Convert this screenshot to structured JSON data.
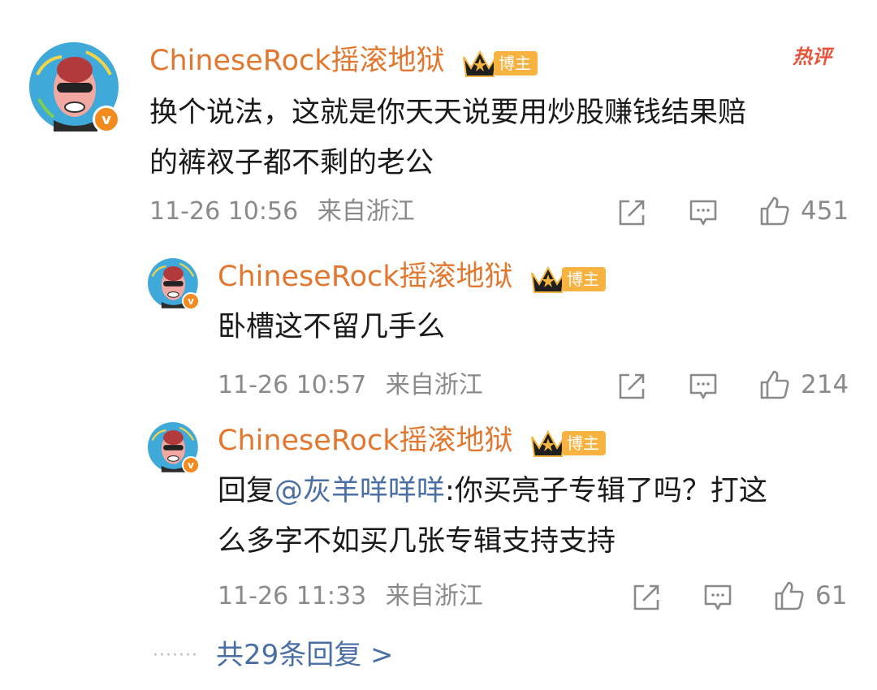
{
  "hot_label": "热评",
  "colors": {
    "username": "#e2772f",
    "mention": "#4a6fa5",
    "meta": "#8a8a8a",
    "badge": "#f7b23f"
  },
  "main_comment": {
    "username": "ChineseRock摇滚地狱",
    "badge": "博主",
    "lines": [
      "换个说法，这就是你天天说要用炒股赚钱结果赔",
      "的裤衩子都不剩的老公"
    ],
    "time": "11-26 10:56",
    "location": "来自浙江",
    "likes": "451"
  },
  "replies": [
    {
      "username": "ChineseRock摇滚地狱",
      "badge": "博主",
      "lines": [
        "卧槽这不留几手么"
      ],
      "time": "11-26 10:57",
      "location": "来自浙江",
      "likes": "214"
    },
    {
      "username": "ChineseRock摇滚地狱",
      "badge": "博主",
      "reply_prefix": "回复",
      "mention": "@灰羊咩咩咩",
      "line1_rest": ":你买亮子专辑了吗？打这",
      "line2": "么多字不如买几张专辑支持支持",
      "time": "11-26 11:33",
      "location": "来自浙江",
      "likes": "61"
    }
  ],
  "more_replies": {
    "dots": "·······",
    "label": "共29条回复 >"
  },
  "icons": [
    "share-icon",
    "comment-icon",
    "like-icon",
    "verified-v-icon",
    "crown-icon"
  ]
}
